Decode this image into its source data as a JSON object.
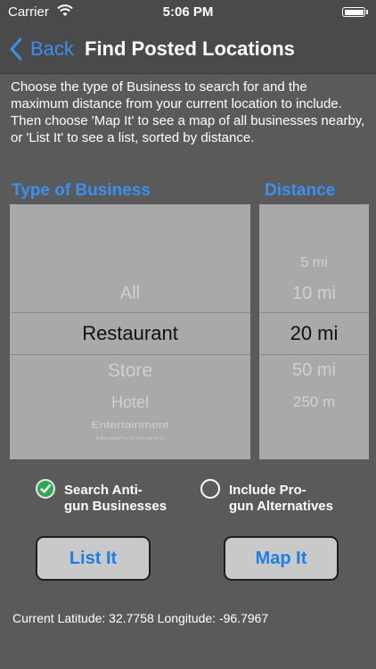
{
  "status_bar": {
    "carrier": "Carrier",
    "time": "5:06 PM",
    "wifi_icon": "wifi-icon",
    "battery_icon": "battery-icon"
  },
  "nav": {
    "back_label": "Back",
    "title": "Find Posted Locations",
    "accent_color": "#3a8ff0"
  },
  "instructions": "Choose the type of Business to search for and the maximum distance from your current location to include.  Then choose 'Map It' to see a map of all businesses nearby, or 'List It' to see a list, sorted by distance.",
  "business_picker": {
    "header": "Type of Business",
    "above": [
      "All"
    ],
    "selected": "Restaurant",
    "below": [
      "Store",
      "Hotel",
      "Entertainment",
      "Health/Fitness"
    ]
  },
  "distance_picker": {
    "header": "Distance",
    "above": [
      "5 mi",
      "10 mi"
    ],
    "selected": "20 mi",
    "below": [
      "50 mi",
      "250 m"
    ]
  },
  "options": {
    "anti": {
      "label": "Search Anti-\ngun Businesses",
      "checked": true
    },
    "pro": {
      "label": "Include Pro-\ngun Alternatives",
      "checked": false
    }
  },
  "buttons": {
    "list_label": "List It",
    "map_label": "Map It"
  },
  "location": {
    "text": "Current Latitude: 32.7758 Longitude: -96.7967"
  }
}
